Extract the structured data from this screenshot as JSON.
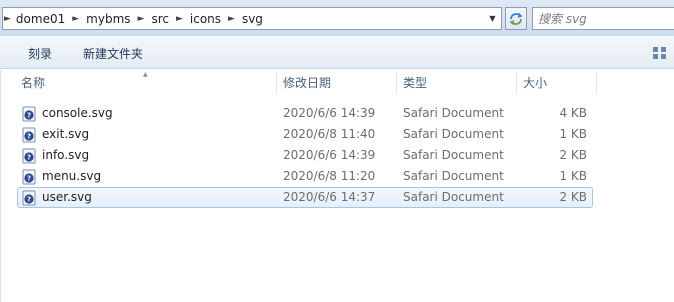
{
  "address": {
    "path": [
      "dome01",
      "mybms",
      "src",
      "icons",
      "svg"
    ]
  },
  "search": {
    "placeholder": "搜索 svg"
  },
  "toolbar": {
    "burn_label": "刻录",
    "new_folder_label": "新建文件夹"
  },
  "columns": {
    "name": "名称",
    "date": "修改日期",
    "type": "类型",
    "size": "大小"
  },
  "files": [
    {
      "name": "console.svg",
      "date": "2020/6/6 14:39",
      "type": "Safari Document",
      "size": "4 KB",
      "selected": false
    },
    {
      "name": "exit.svg",
      "date": "2020/6/8 11:40",
      "type": "Safari Document",
      "size": "1 KB",
      "selected": false
    },
    {
      "name": "info.svg",
      "date": "2020/6/6 14:39",
      "type": "Safari Document",
      "size": "2 KB",
      "selected": false
    },
    {
      "name": "menu.svg",
      "date": "2020/6/8 11:20",
      "type": "Safari Document",
      "size": "1 KB",
      "selected": false
    },
    {
      "name": "user.svg",
      "date": "2020/6/6 14:37",
      "type": "Safari Document",
      "size": "2 KB",
      "selected": true
    }
  ],
  "icons": {
    "file": "safari-document-icon",
    "refresh": "refresh-icon",
    "view": "view-options-icon"
  },
  "colors": {
    "toolbar_text": "#1e395b",
    "selection_border": "#a9c3e6",
    "secondary_text": "#6d6d6d"
  }
}
